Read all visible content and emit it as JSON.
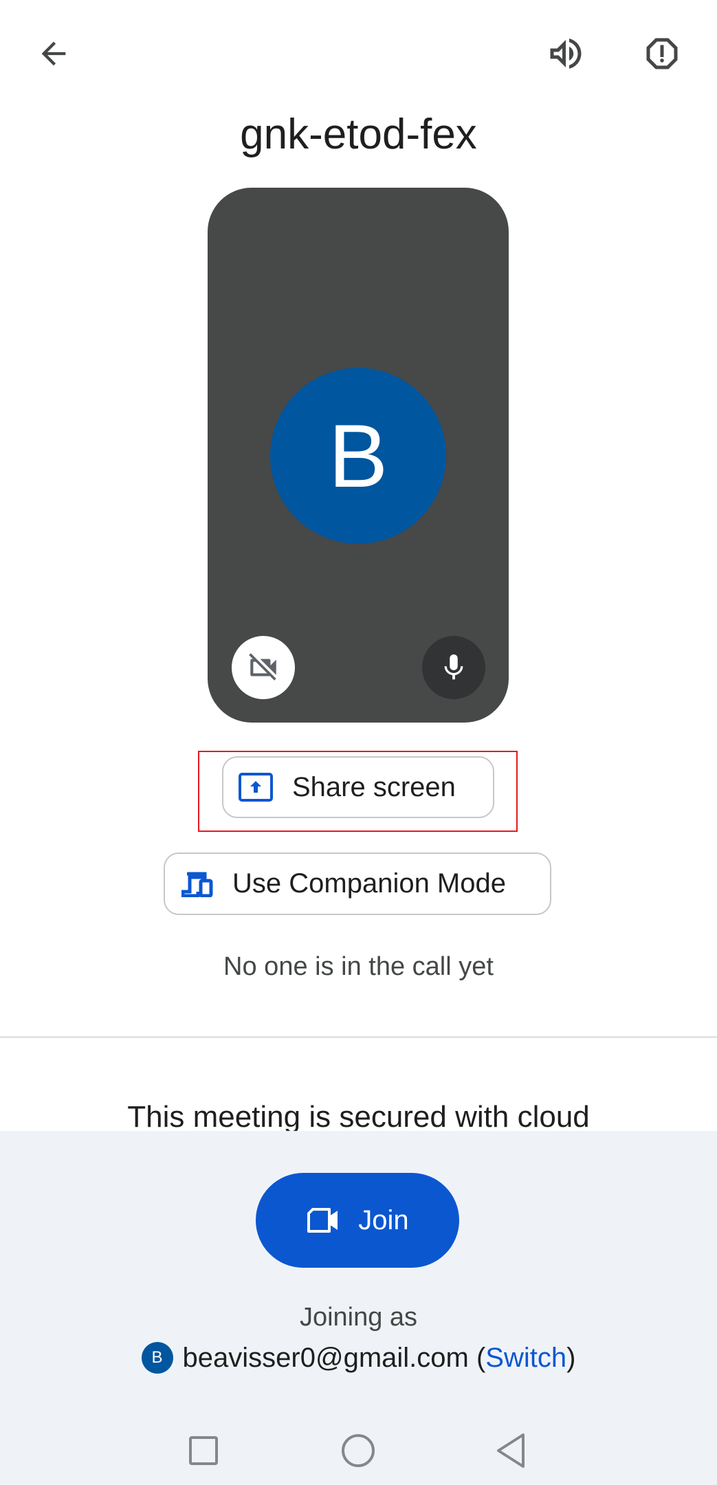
{
  "header": {
    "back_icon": "arrow-left-icon",
    "speaker_icon": "volume-up-icon",
    "report_icon": "report-octagon-icon"
  },
  "meeting": {
    "code": "gnk-etod-fex"
  },
  "preview": {
    "avatar_initial": "B",
    "camera_icon": "videocam-off-icon",
    "mic_icon": "mic-icon"
  },
  "actions": {
    "share_screen_label": "Share screen",
    "share_screen_icon": "present-to-all-icon",
    "companion_label": "Use Companion Mode",
    "companion_icon": "devices-icon"
  },
  "status_text": "No one is in the call yet",
  "security_text": "This meeting is secured with cloud",
  "join": {
    "label": "Join",
    "icon": "videocam-icon",
    "joining_as_label": "Joining as",
    "account_initial": "B",
    "email": "beavisser0@gmail.com",
    "paren_open": " (",
    "switch_label": "Switch",
    "paren_close": ")"
  },
  "nav": {
    "recents_icon": "square-icon",
    "home_icon": "circle-icon",
    "back_icon": "triangle-back-icon"
  },
  "colors": {
    "accent": "#0b57d0",
    "avatar": "#00569f",
    "preview_bg": "#474848",
    "highlight": "#e5191f",
    "bottom_panel": "#eff3f8"
  }
}
